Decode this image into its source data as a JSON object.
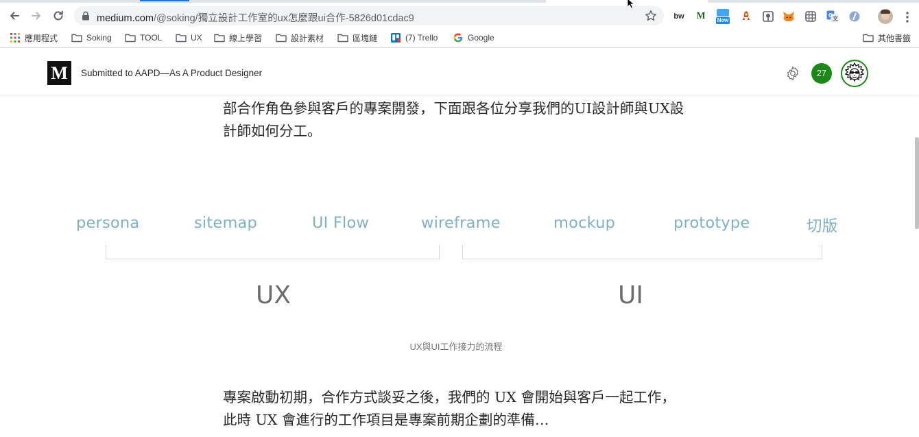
{
  "browser": {
    "url_host": "medium.com",
    "url_path": "/@soking/獨立設計工作室的ux怎麼跟ui合作-5826d01cdac9",
    "extensions": [
      {
        "name": "bw-extension-icon",
        "label": "bw",
        "bg": "#ffffff",
        "color": "#2d2d2d"
      },
      {
        "name": "medium-extension-icon",
        "label": "M",
        "bg": "#ffffff",
        "color": "#1b5e20"
      },
      {
        "name": "new-extension-icon",
        "label": "New",
        "bg": "#1e88e5",
        "color": "#ffffff"
      },
      {
        "name": "rocket-extension-icon",
        "label": "",
        "bg": "#ffffff",
        "color": "#e65100"
      },
      {
        "name": "pin-extension-icon",
        "label": "",
        "bg": "#ffffff",
        "color": "#5f6368"
      },
      {
        "name": "metamask-extension-icon",
        "label": "",
        "bg": "#ffffff",
        "color": "#f6851b"
      },
      {
        "name": "grid-extension-icon",
        "label": "",
        "bg": "#ffffff",
        "color": "#5f6368"
      },
      {
        "name": "translate-extension-icon",
        "label": "",
        "bg": "#ffffff",
        "color": "#4285f4"
      },
      {
        "name": "circle-extension-icon",
        "label": "",
        "bg": "#ffffff",
        "color": "#5f6368"
      }
    ]
  },
  "bookmarks": {
    "apps": "應用程式",
    "items": [
      "Soking",
      "TOOL",
      "UX",
      "線上學習",
      "設計素材",
      "區塊鏈"
    ],
    "trello": "(7) Trello",
    "google": "Google",
    "other": "其他書籤"
  },
  "medium": {
    "logo": "M",
    "submitted": "Submitted to AAPD—As A Product Designer",
    "notification_count": "27"
  },
  "article": {
    "paragraph1": "部合作角色參與客戶的專案開發，下面跟各位分享我們的UI設計師與UX設計師如何分工。",
    "flow_steps": [
      "persona",
      "sitemap",
      "UI Flow",
      "wireframe",
      "mockup",
      "prototype",
      "切版"
    ],
    "group_ux": "UX",
    "group_ui": "UI",
    "caption": "UX與UI工作接力的流程",
    "paragraph2": "專案啟動初期，合作方式談妥之後，我們的 UX 會開始與客戶一起工作，此時 UX 會進行的工作項目是專案前期企劃的準備…"
  },
  "colors": {
    "flow_text": "#7fb1c4",
    "medium_green": "#1a8917"
  }
}
